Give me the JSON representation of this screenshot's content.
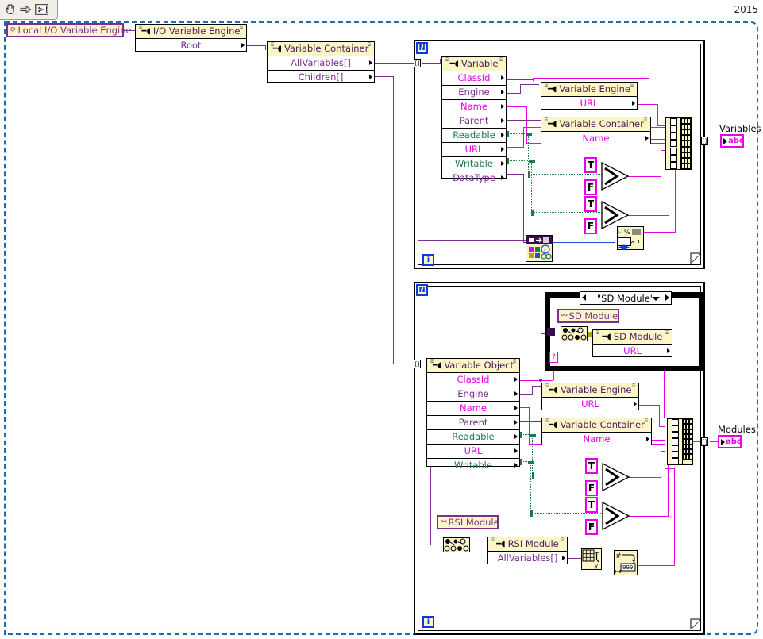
{
  "toolbar": {
    "items": [
      {
        "name": "hand-tool-icon",
        "glyph": "✋"
      },
      {
        "name": "arrow-icon",
        "glyph": "➡"
      },
      {
        "name": "vi-icon",
        "glyph": "▣"
      }
    ]
  },
  "version_label": "2015",
  "constants": {
    "local_io_variable_engine": "Local I/O Variable Engine",
    "sd_module": "SD Module",
    "rsi_module": "RSI Module",
    "case_selector": "\"SD Module\"",
    "true_label": "T",
    "false_label": "F"
  },
  "nodes": {
    "io_variable_engine": {
      "title": "I/O Variable Engine",
      "rows": [
        "Root"
      ]
    },
    "variable_container_root": {
      "title": "Variable Container",
      "rows": [
        "AllVariables[]",
        "Children[]"
      ]
    },
    "variable": {
      "title": "Variable",
      "rows": [
        "ClassId",
        "Engine",
        "Name",
        "Parent",
        "Readable",
        "URL",
        "Writable",
        "DataType"
      ]
    },
    "variable_engine_1": {
      "title": "Variable Engine",
      "rows": [
        "URL"
      ]
    },
    "variable_container_1": {
      "title": "Variable Container",
      "rows": [
        "Name"
      ]
    },
    "sd_module_node": {
      "title": "SD Module",
      "rows": [
        "URL"
      ]
    },
    "variable_object": {
      "title": "Variable Object",
      "rows": [
        "ClassId",
        "Engine",
        "Name",
        "Parent",
        "Readable",
        "URL",
        "Writable"
      ]
    },
    "variable_engine_2": {
      "title": "Variable Engine",
      "rows": [
        "URL"
      ]
    },
    "variable_container_2": {
      "title": "Variable Container",
      "rows": [
        "Name"
      ]
    },
    "rsi_module_node": {
      "title": "RSI Module",
      "rows": [
        "AllVariables[]"
      ]
    }
  },
  "loops": {
    "loop1": {
      "count_terminal": "N",
      "iteration_terminal": "i"
    },
    "loop2": {
      "count_terminal": "N",
      "iteration_terminal": "i"
    }
  },
  "indicators": {
    "variables": {
      "label": "Variables",
      "type": "abc"
    },
    "modules": {
      "label": "Modules",
      "type": "abc"
    }
  },
  "row_colors": {
    "ClassId": "magenta",
    "Engine": "purple",
    "Name": "magenta",
    "Parent": "purple",
    "Readable": "green",
    "URL": "magenta",
    "Writable": "green",
    "DataType": "purple",
    "Root": "purple",
    "AllVariables[]": "purple",
    "Children[]": "purple"
  },
  "palette": {
    "string_wire": "#e800e8",
    "object_wire": "#7b2f8e",
    "boolean_wire": "#1a7a4a",
    "numeric_wire": "#1f4fd8",
    "node_header": "#fbf5c8",
    "diagram_border": "#1b6ca8"
  }
}
